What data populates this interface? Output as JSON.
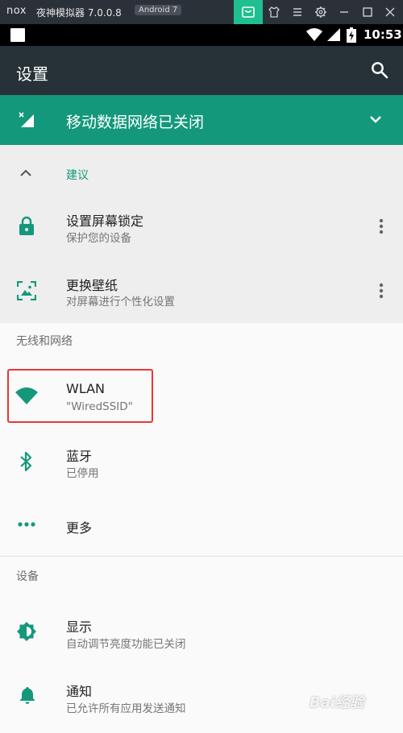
{
  "emulator": {
    "logo": "nox",
    "title": "夜神模拟器 7.0.0.8",
    "android_badge": "Android 7",
    "icons": [
      "shopping-bag-icon",
      "shirt-icon",
      "menu-icon",
      "gear-icon",
      "minimize-icon",
      "maximize-icon",
      "close-icon"
    ]
  },
  "status_bar": {
    "time": "10:53",
    "icons": [
      "notification-square-icon",
      "wifi-icon",
      "signal-icon",
      "battery-charging-icon"
    ]
  },
  "app_bar": {
    "title": "设置",
    "search_icon": "search-icon"
  },
  "banner": {
    "text": "移动数据网络已关闭",
    "icon": "mobile-data-off-icon",
    "action_icon": "chevron-down-icon"
  },
  "suggestions": {
    "header": "建议",
    "items": [
      {
        "title": "设置屏幕锁定",
        "subtitle": "保护您的设备",
        "icon": "lock-icon"
      },
      {
        "title": "更换壁纸",
        "subtitle": "对屏幕进行个性化设置",
        "icon": "wallpaper-icon"
      }
    ]
  },
  "sections": [
    {
      "header": "无线和网络",
      "items": [
        {
          "title": "WLAN",
          "subtitle": "\"WiredSSID\"",
          "icon": "wifi-icon"
        },
        {
          "title": "蓝牙",
          "subtitle": "已停用",
          "icon": "bluetooth-icon"
        },
        {
          "title": "更多",
          "subtitle": "",
          "icon": "more-horizontal-icon"
        }
      ]
    },
    {
      "header": "设备",
      "items": [
        {
          "title": "显示",
          "subtitle": "自动调节亮度功能已关闭",
          "icon": "brightness-icon"
        },
        {
          "title": "通知",
          "subtitle": "已允许所有应用发送通知",
          "icon": "bell-icon"
        }
      ]
    }
  ],
  "watermark": "Bai经验",
  "colors": {
    "accent": "#14987c",
    "app_bar": "#263238",
    "highlight": "#e53935"
  }
}
